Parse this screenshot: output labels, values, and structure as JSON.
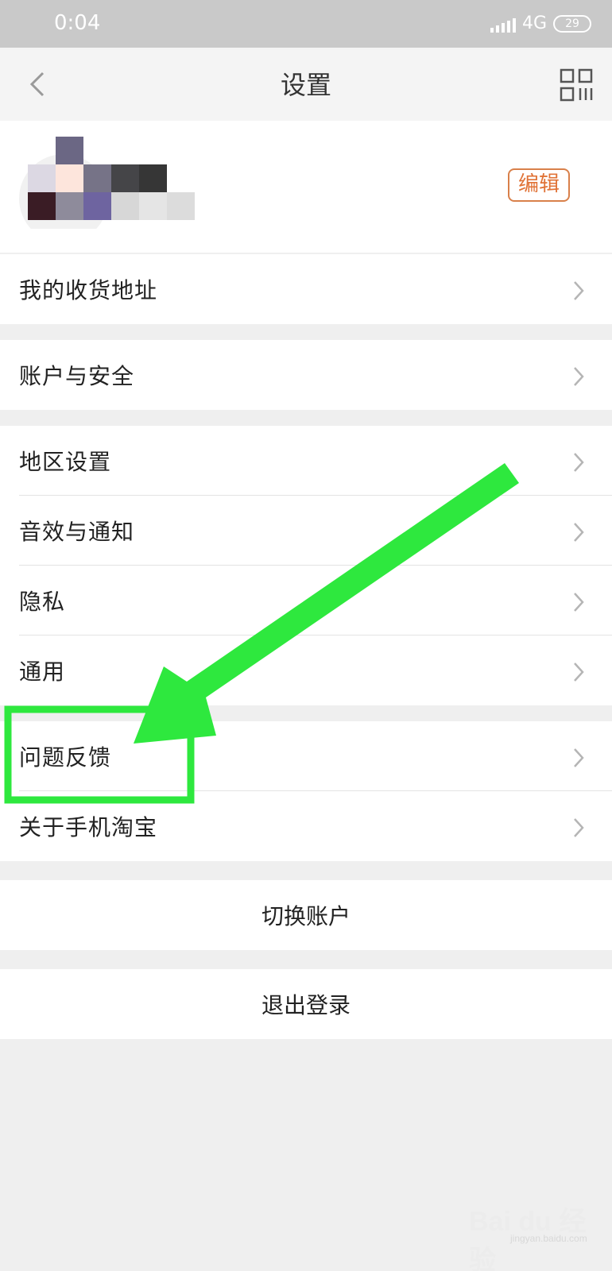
{
  "status_bar": {
    "time": "0:04",
    "network": "4G",
    "battery": "29"
  },
  "nav": {
    "title": "设置",
    "back_icon": "chevron-left-icon",
    "qr_icon": "qr-code-icon"
  },
  "profile": {
    "edit_label": "编辑",
    "edit_color": "#e07236"
  },
  "menu": {
    "address": "我的收货地址",
    "account_security": "账户与安全",
    "region": "地区设置",
    "sound_notify": "音效与通知",
    "privacy": "隐私",
    "general": "通用",
    "feedback": "问题反馈",
    "about": "关于手机淘宝"
  },
  "actions": {
    "switch_account": "切换账户",
    "logout": "退出登录"
  },
  "annotation": {
    "highlight_color": "#2ee83e"
  },
  "watermark": {
    "main": "Bai du 经验",
    "sub": "jingyan.baidu.com"
  }
}
